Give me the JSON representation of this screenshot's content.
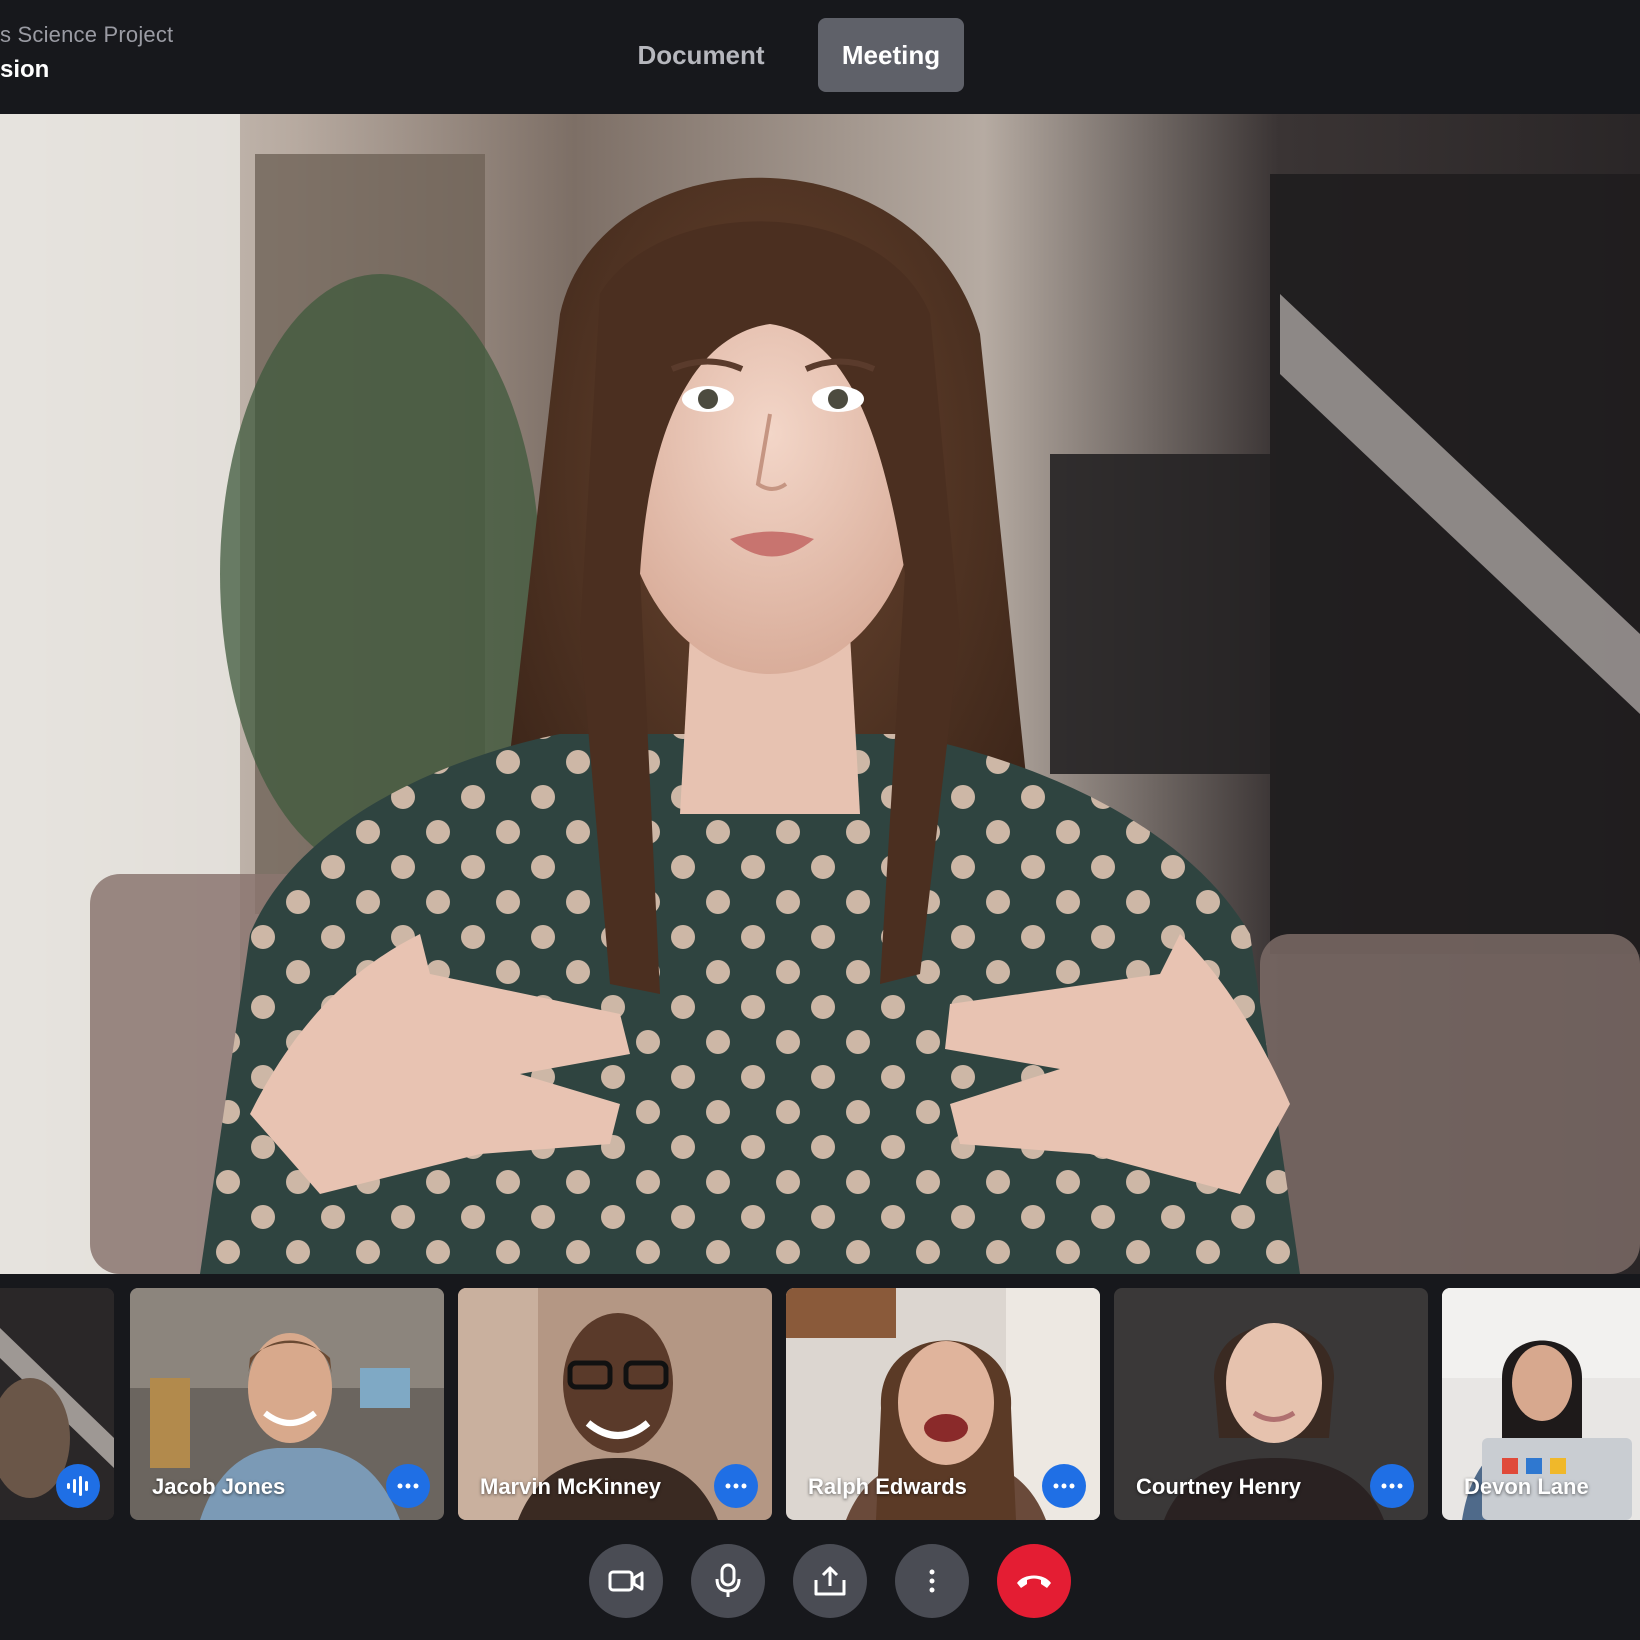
{
  "header": {
    "project_subtitle": "s Science Project",
    "project_title": "sion",
    "tabs": [
      {
        "label": "Document",
        "active": false
      },
      {
        "label": "Meeting",
        "active": true
      }
    ]
  },
  "participants": [
    {
      "name": "",
      "action_icon": "audio-wave-icon"
    },
    {
      "name": "Jacob Jones",
      "action_icon": "more-dots-icon"
    },
    {
      "name": "Marvin McKinney",
      "action_icon": "more-dots-icon"
    },
    {
      "name": "Ralph Edwards",
      "action_icon": "more-dots-icon"
    },
    {
      "name": "Courtney Henry",
      "action_icon": "more-dots-icon"
    },
    {
      "name": "Devon Lane",
      "action_icon": ""
    }
  ],
  "controls": [
    {
      "icon": "video-camera-icon"
    },
    {
      "icon": "microphone-icon"
    },
    {
      "icon": "share-screen-icon"
    },
    {
      "icon": "more-options-icon"
    },
    {
      "icon": "end-call-icon"
    }
  ],
  "colors": {
    "background": "#17181c",
    "tab_active": "#5f6169",
    "accent_blue": "#1f6fe5",
    "end_call_red": "#e41d33",
    "control_gray": "#4a4c54"
  }
}
